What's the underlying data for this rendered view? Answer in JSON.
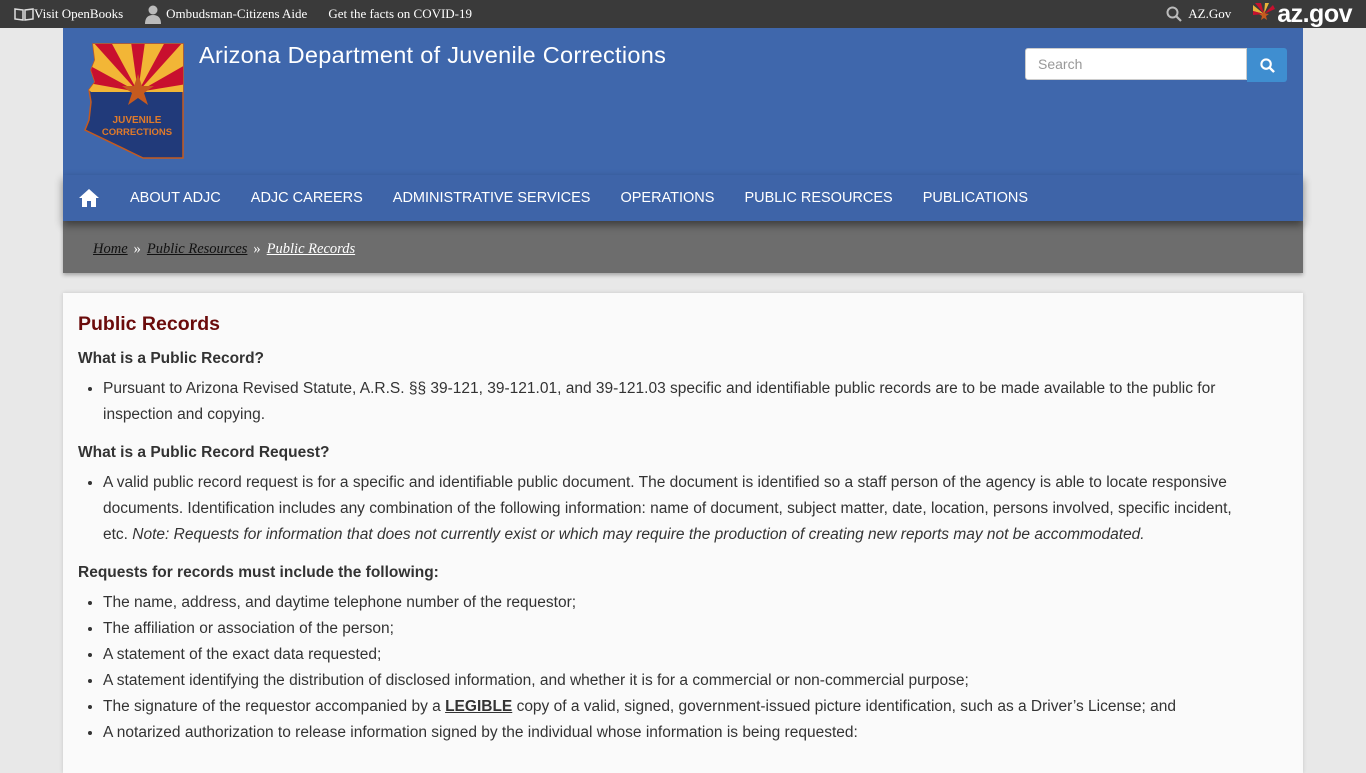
{
  "topbar": {
    "openbooks": "Visit OpenBooks",
    "ombudsman": "Ombudsman-Citizens Aide",
    "covid": "Get the facts on COVID-19",
    "azgov_link": "AZ.Gov",
    "azgov_logo": "az.gov"
  },
  "header": {
    "logo_line1": "JUVENILE",
    "logo_line2": "CORRECTIONS",
    "title": "Arizona Department of Juvenile Corrections",
    "search_placeholder": "Search"
  },
  "nav": {
    "items": [
      "ABOUT ADJC",
      "ADJC CAREERS",
      "ADMINISTRATIVE SERVICES",
      "OPERATIONS",
      "PUBLIC RESOURCES",
      "PUBLICATIONS"
    ]
  },
  "breadcrumb": {
    "home": "Home",
    "section": "Public Resources",
    "current": "Public Records",
    "separator": "»"
  },
  "content": {
    "title": "Public Records",
    "q1": "What is a Public Record?",
    "q1_text": "Pursuant to Arizona Revised Statute, A.R.S. §§ 39-121, 39-121.01, and 39-121.03 specific and identifiable public records are to be made available to the public for inspection and copying.",
    "q2": "What is a Public Record Request?",
    "q2_text": "A valid public record request is for a specific and identifiable public document. The document is identified so a staff person of the agency is able to locate responsive documents. Identification includes any combination of the following information: name of document, subject matter, date, location, persons involved, specific incident, etc.",
    "q2_note": "Note: Requests for information that does not currently exist or which may require the production of creating new reports may not be accommodated.",
    "q3": "Requests for records must include the following:",
    "req1": "The name, address, and daytime telephone number of the requestor;",
    "req2": "The affiliation or association of the person;",
    "req3": "A statement of the exact data requested;",
    "req4": "A statement identifying the distribution of disclosed information, and whether it is for a commercial or non-commercial purpose;",
    "req5_a": "The signature of the requestor accompanied by a",
    "req5_legible": "LEGIBLE",
    "req5_b": "copy of a valid, signed, government-issued picture identification, such as a Driver’s License; and",
    "req6": "A notarized authorization to release information signed by the individual whose information is being requested:"
  },
  "colors": {
    "header_blue": "#3f67ac",
    "title_red": "#6b0c0c",
    "search_button": "#3f8ed0"
  }
}
